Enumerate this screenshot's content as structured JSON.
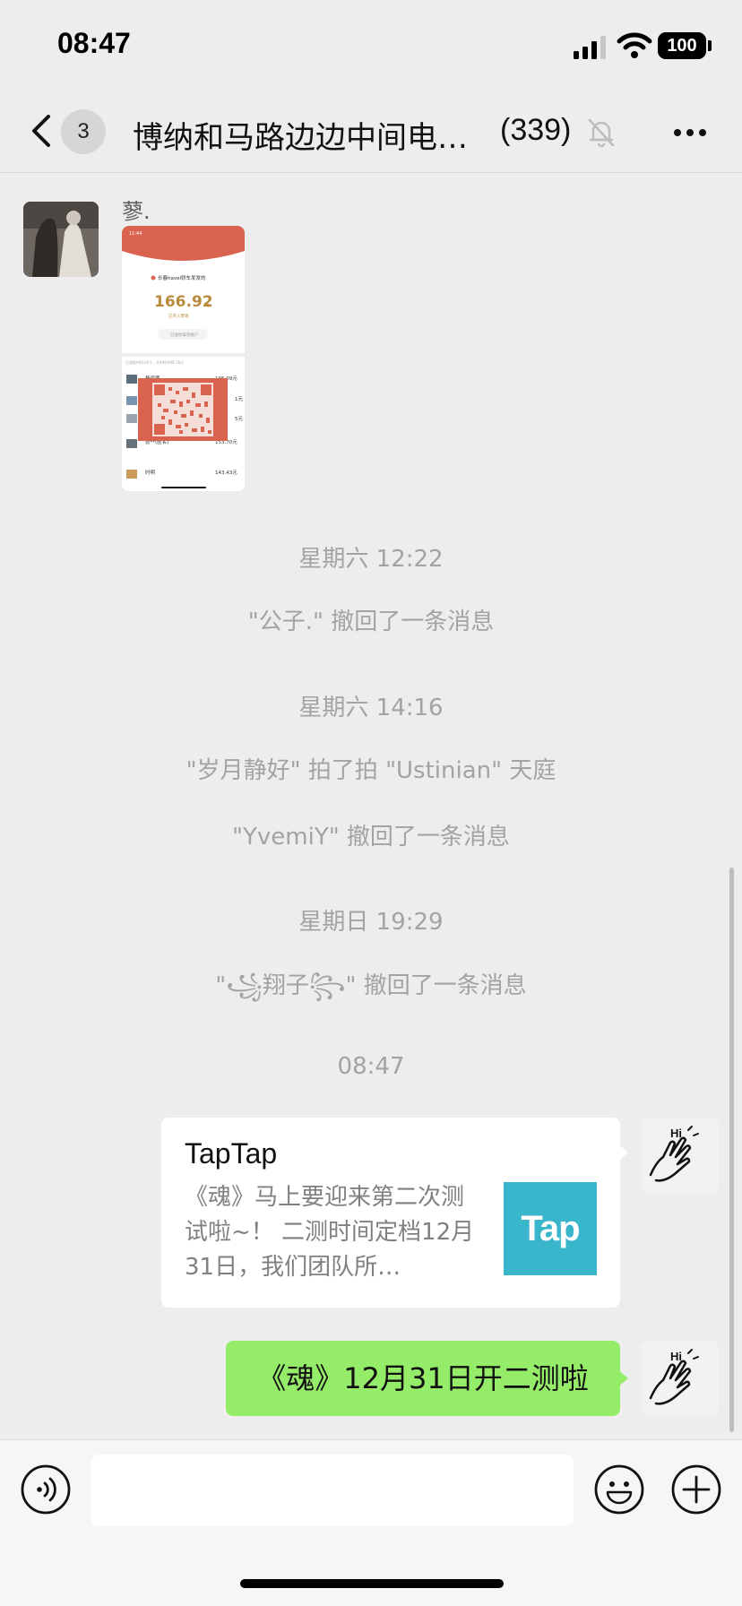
{
  "status_bar": {
    "time": "08:47",
    "battery": "100",
    "icons": [
      "signal-icon",
      "wifi-icon",
      "battery-icon"
    ]
  },
  "nav": {
    "back_icon": "chevron-left-icon",
    "unread_badge": "3",
    "title": "博纳和马路边边中间电…",
    "member_count": "(339)",
    "mute_icon": "bell-slash-icon",
    "more_icon": "ellipsis-icon"
  },
  "messages": {
    "first": {
      "sender": "蓼.",
      "image_type": "screenshot"
    },
    "system": [
      "星期六 12:22",
      "\"公子.\" 撤回了一条消息",
      "星期六 14:16",
      "\"岁月静好\" 拍了拍 \"Ustinian\" 天庭",
      "\"YvemiY\" 撤回了一条消息",
      "星期日 19:29",
      "\"꧁翔子꧂\" 撤回了一条消息",
      "08:47"
    ],
    "card": {
      "title": "TapTap",
      "description": "《魂》马上要迎来第二次测试啦~！ 二测时间定档12月31日，我们团队所…",
      "thumb_text": "Tap"
    },
    "text": "《魂》12月31日开二测啦",
    "self_avatar_text": "Hi"
  },
  "screenshot": {
    "time": "11:44",
    "header": "长春havel轿车发发的",
    "amount": "166.92",
    "amount_unit": "元",
    "sub": "已存入零钱",
    "button": "已收你拿到账户",
    "stats": "已领取99/100个，共499/498.78元",
    "rows": [
      {
        "name": "杨海莲",
        "amount": "195.09元"
      },
      {
        "name": "",
        "amount": "1元"
      },
      {
        "name": "",
        "amount": "5元"
      },
      {
        "name": "张**(匿名)",
        "amount": "153.70元"
      },
      {
        "name": "时明",
        "amount": "143.43元"
      }
    ]
  },
  "input": {
    "voice_icon": "voice-icon",
    "emoji_icon": "emoji-icon",
    "plus_icon": "plus-icon",
    "placeholder": ""
  },
  "colors": {
    "background": "#ededed",
    "bubble_green": "#95ec69",
    "system_text": "#a3a3a3",
    "accent_tap": "#39b6cc",
    "packet_red": "#d9634f"
  }
}
